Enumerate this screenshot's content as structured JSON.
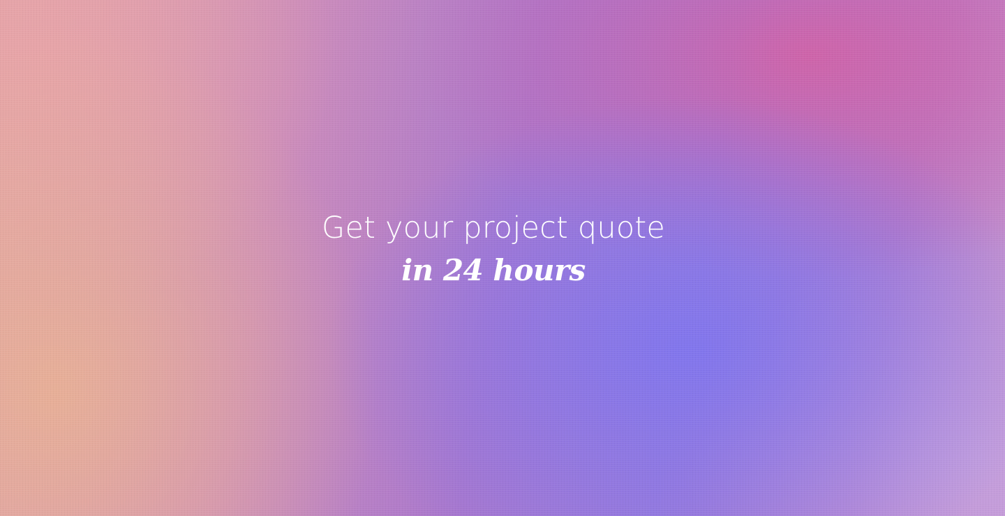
{
  "hero": {
    "headline_line1": "Get your project quote",
    "headline_line2": "in 24 hours"
  },
  "colors": {
    "text": "#ffffff",
    "gradient_peach": "#e8b096",
    "gradient_pink": "#d660a2",
    "gradient_violet": "#8076ee",
    "gradient_lilac": "#c4a0de"
  }
}
